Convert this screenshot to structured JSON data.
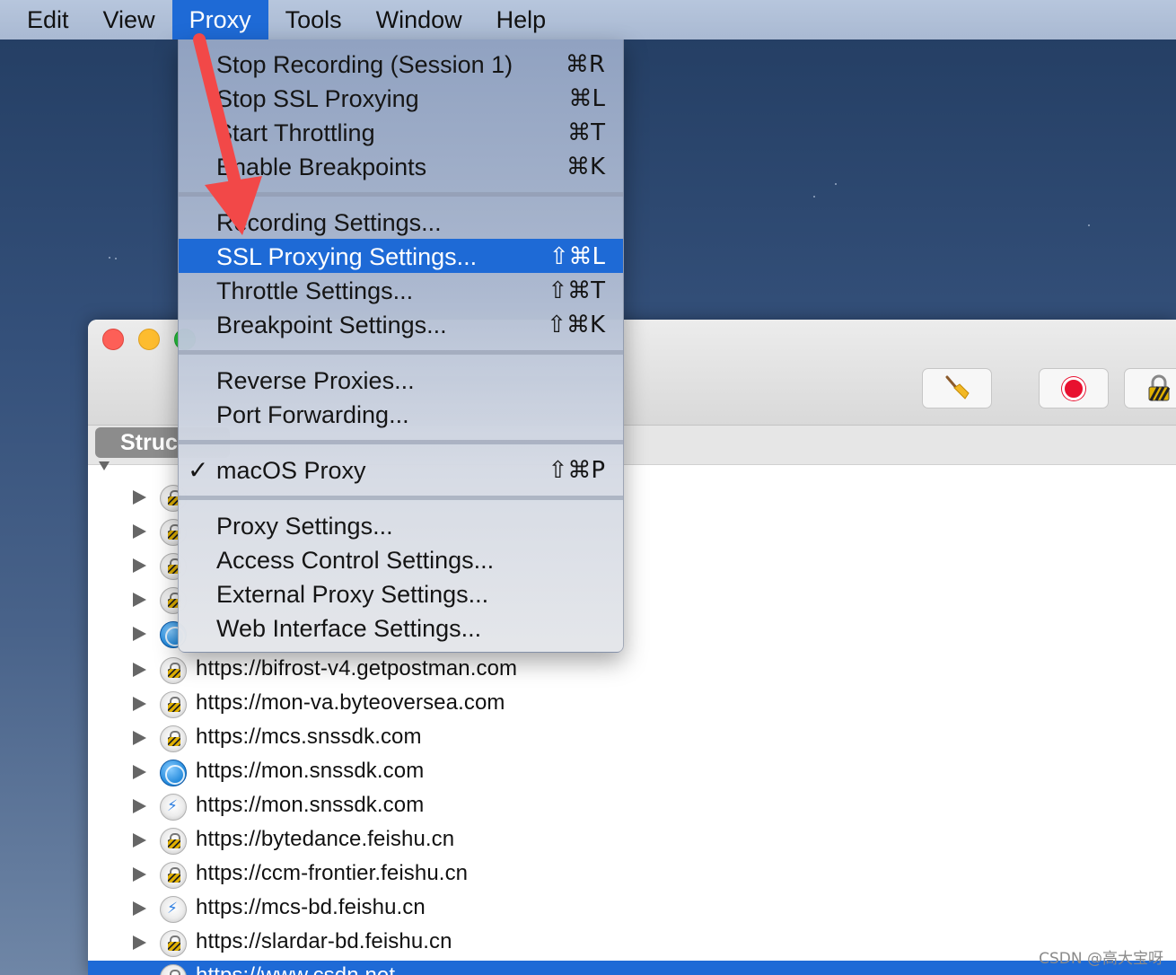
{
  "menubar": {
    "items": [
      {
        "label": "Edit"
      },
      {
        "label": "View"
      },
      {
        "label": "Proxy"
      },
      {
        "label": "Tools"
      },
      {
        "label": "Window"
      },
      {
        "label": "Help"
      }
    ],
    "active": "Proxy"
  },
  "proxy_menu": {
    "items": [
      {
        "label": "Stop Recording (Session 1)",
        "shortcut": "⌘R"
      },
      {
        "label": "Stop SSL Proxying",
        "shortcut": "⌘L"
      },
      {
        "label": "Start Throttling",
        "shortcut": "⌘T"
      },
      {
        "label": "Enable Breakpoints",
        "shortcut": "⌘K"
      },
      {
        "label": "Recording Settings..."
      },
      {
        "label": "SSL Proxying Settings...",
        "shortcut": "⇧⌘L"
      },
      {
        "label": "Throttle Settings...",
        "shortcut": "⇧⌘T"
      },
      {
        "label": "Breakpoint Settings...",
        "shortcut": "⇧⌘K"
      },
      {
        "label": "Reverse Proxies..."
      },
      {
        "label": "Port Forwarding..."
      },
      {
        "label": "macOS Proxy",
        "shortcut": "⇧⌘P",
        "check": "✓"
      },
      {
        "label": "Proxy Settings..."
      },
      {
        "label": "Access Control Settings..."
      },
      {
        "label": "External Proxy Settings..."
      },
      {
        "label": "Web Interface Settings..."
      }
    ],
    "highlighted": "SSL Proxying Settings..."
  },
  "app": {
    "tab_label": "Struc",
    "colors": {
      "accent": "#1e6ad6",
      "record": "#e8102f",
      "annotation_arrow": "#f24848"
    },
    "hosts": [
      {
        "url": "https://bifrost-v4.getpostman.com",
        "icon": "lock-icon"
      },
      {
        "url": "https://mon-va.byteoversea.com",
        "icon": "lock-icon"
      },
      {
        "url": "https://mcs.snssdk.com",
        "icon": "lock-icon"
      },
      {
        "url": "https://mon.snssdk.com",
        "icon": "globe-icon"
      },
      {
        "url": "https://mon.snssdk.com",
        "icon": "bolt-lock-icon"
      },
      {
        "url": "https://bytedance.feishu.cn",
        "icon": "lock-icon"
      },
      {
        "url": "https://ccm-frontier.feishu.cn",
        "icon": "lock-icon"
      },
      {
        "url": "https://mcs-bd.feishu.cn",
        "icon": "bolt-lock-icon"
      },
      {
        "url": "https://slardar-bd.feishu.cn",
        "icon": "lock-icon"
      },
      {
        "url": "https://www.csdn.net",
        "icon": "lock-icon",
        "selected": true
      }
    ]
  },
  "watermark": "CSDN @高大宝呀"
}
